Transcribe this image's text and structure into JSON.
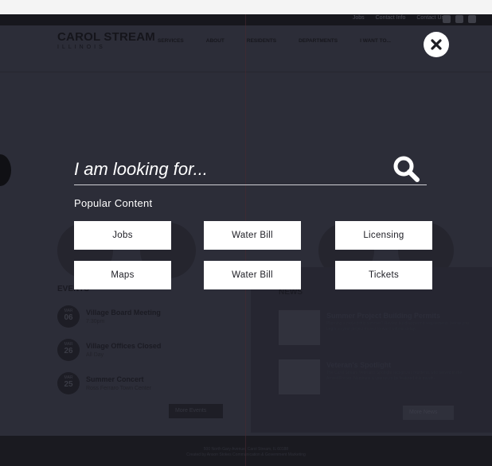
{
  "site": {
    "logo_main": "CAROL STREAM",
    "logo_sub": "ILLINOIS",
    "utility_links": [
      "Jobs",
      "Contact Info",
      "Contact Us"
    ],
    "nav": [
      "SERVICES",
      "ABOUT",
      "RESIDENTS",
      "DEPARTMENTS",
      "I WANT TO..."
    ],
    "events_title": "EVENTS",
    "events": [
      {
        "month": "MAR",
        "day": "06",
        "title": "Village Board Meeting",
        "sub": "7:30pm"
      },
      {
        "month": "MAR",
        "day": "26",
        "title": "Village Offices Closed",
        "sub": "All Day"
      },
      {
        "month": "MAR",
        "day": "25",
        "title": "Summer Concert",
        "sub": "Ross Ferraro Town Center"
      }
    ],
    "more_events": "More Events",
    "news_title": "NEWS",
    "news": [
      {
        "title": "Summer Project Building Permits",
        "text": "Planning a project this summer? Review building permit requirements before you begin so your project moves forward without delay."
      },
      {
        "title": "Veteran's Spotlight",
        "text": "The Carol Stream Veteran's Spotlight recognizes residents who served in the Armed Forces. Nominate a veteran to be featured this month."
      }
    ],
    "more_news": "More News",
    "footer_lines": [
      "500 North Gary Avenue, Carol Stream, IL 60188",
      "Created by Anson Stokes Communication & Government Marketing"
    ]
  },
  "overlay": {
    "search_placeholder": "I am looking for...",
    "popular_heading": "Popular Content",
    "popular_items": [
      "Jobs",
      "Water Bill",
      "Licensing",
      "Maps",
      "Water Bill",
      "Tickets"
    ]
  },
  "colors": {
    "overlay_bg": "#2c2d38",
    "button_bg": "#ffffff",
    "text_light": "#ffffff"
  },
  "icons": {
    "close": "close-icon",
    "search": "search-icon",
    "more": "arrow-right-circle-icon"
  }
}
